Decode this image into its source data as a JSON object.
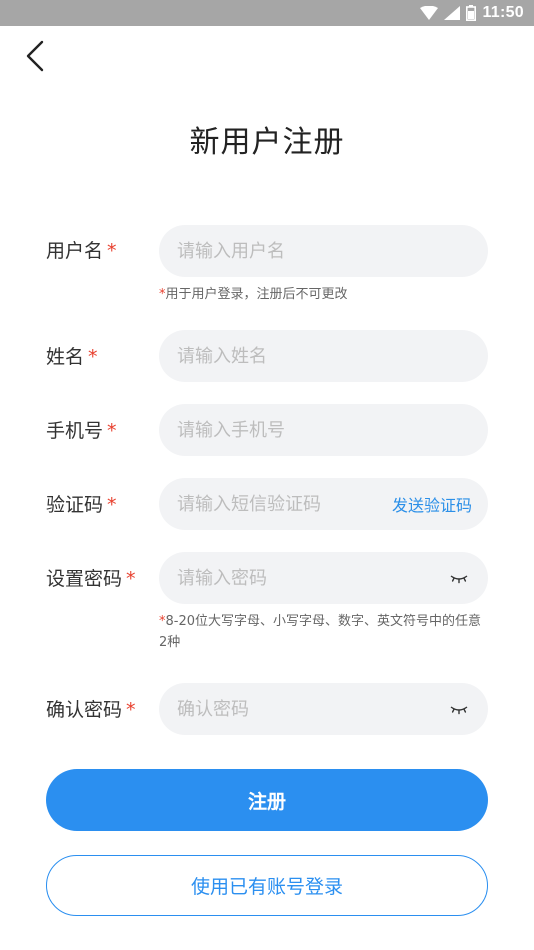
{
  "status_bar": {
    "time": "11:50"
  },
  "title": "新用户注册",
  "required_mark": "*",
  "fields": {
    "username": {
      "label": "用户名",
      "placeholder": "请输入用户名",
      "hint_mark": "*",
      "hint": "用于用户登录，注册后不可更改"
    },
    "name": {
      "label": "姓名",
      "placeholder": "请输入姓名"
    },
    "phone": {
      "label": "手机号",
      "placeholder": "请输入手机号"
    },
    "code": {
      "label": "验证码",
      "placeholder": "请输入短信验证码",
      "action": "发送验证码"
    },
    "password": {
      "label": "设置密码",
      "placeholder": "请输入密码",
      "hint_mark": "*",
      "hint": "8-20位大写字母、小写字母、数字、英文符号中的任意2种"
    },
    "confirm": {
      "label": "确认密码",
      "placeholder": "确认密码"
    }
  },
  "buttons": {
    "register": "注册",
    "login": "使用已有账号登录"
  },
  "colors": {
    "accent": "#2b8ff0",
    "required": "#e8402e",
    "field_bg": "#f2f3f5",
    "status_bar": "#a6a6a6"
  },
  "icons": [
    "wifi-icon",
    "signal-icon",
    "battery-icon",
    "back-arrow-icon",
    "eye-closed-icon"
  ]
}
